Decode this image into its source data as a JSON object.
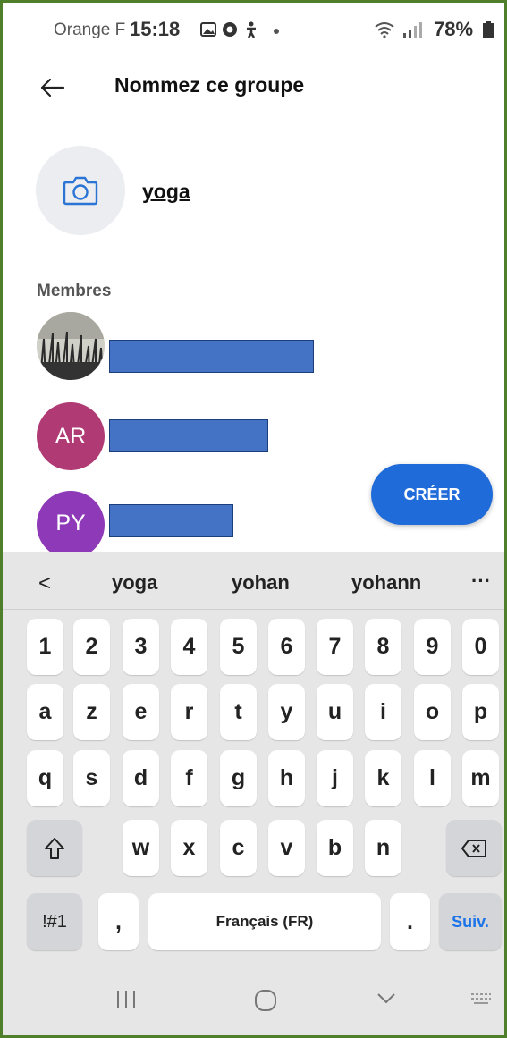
{
  "status_bar": {
    "carrier": "Orange F",
    "time": "15:18",
    "battery": "78%",
    "icons": [
      "gallery-icon",
      "chrome-icon",
      "accessibility-icon",
      "dot-icon",
      "wifi-icon",
      "signal-icon",
      "battery-icon"
    ]
  },
  "header": {
    "title": "Nommez ce groupe",
    "back_icon": "arrow-left-icon"
  },
  "group": {
    "photo_icon": "camera-icon",
    "name": "yoga"
  },
  "members": {
    "title": "Membres",
    "items": [
      {
        "initials": "",
        "avatar": "photo",
        "name_redacted": true
      },
      {
        "initials": "AR",
        "color": "#b03a74",
        "name_redacted": true
      },
      {
        "initials": "PY",
        "color": "#8e3ab8",
        "name_redacted": true
      }
    ]
  },
  "create_button": {
    "label": "CRÉER",
    "color": "#1f6bd9"
  },
  "keyboard": {
    "collapse_label": "<",
    "suggestions": [
      "yoga",
      "yohan",
      "yohann"
    ],
    "more_label": "···",
    "row_numbers": [
      "1",
      "2",
      "3",
      "4",
      "5",
      "6",
      "7",
      "8",
      "9",
      "0"
    ],
    "row1": [
      "a",
      "z",
      "e",
      "r",
      "t",
      "y",
      "u",
      "i",
      "o",
      "p"
    ],
    "row2": [
      "q",
      "s",
      "d",
      "f",
      "g",
      "h",
      "j",
      "k",
      "l",
      "m"
    ],
    "row3": [
      "w",
      "x",
      "c",
      "v",
      "b",
      "n"
    ],
    "shift_icon": "shift-icon",
    "backspace_icon": "backspace-icon",
    "symbols_label": "!#1",
    "comma_label": ",",
    "space_label": "Français (FR)",
    "period_label": ".",
    "next_label": "Suiv.",
    "next_color": "#1a73e8"
  },
  "nav_bar": {
    "icons": [
      "recent-apps-icon",
      "home-icon",
      "hide-keyboard-icon",
      "keyboard-switch-icon"
    ]
  }
}
